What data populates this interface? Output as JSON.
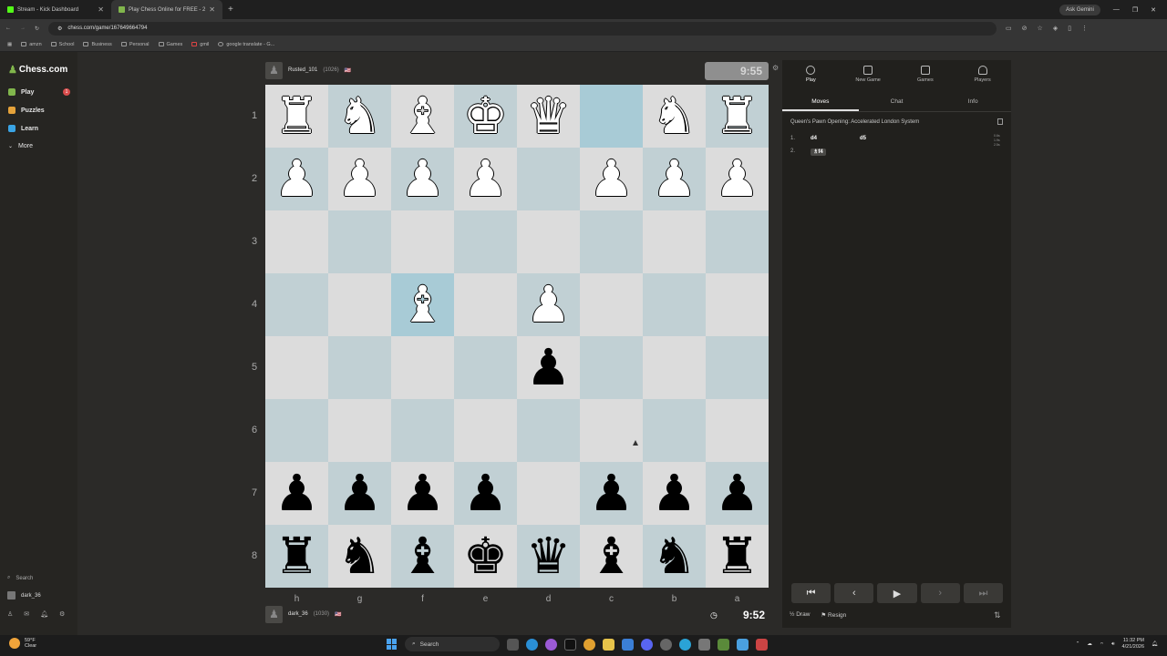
{
  "browser": {
    "tabs": [
      {
        "label": "Stream - Kick Dashboard",
        "active": false,
        "color": "#53fc18"
      },
      {
        "label": "Play Chess Online for FREE - 2",
        "active": true,
        "color": "#81b64c"
      }
    ],
    "url": "chess.com/game/167649664794",
    "gemini": "Ask Gemini",
    "bookmarks": [
      "amzn",
      "School",
      "Business",
      "Personal",
      "Games",
      "gmil",
      "google translate - G..."
    ]
  },
  "sidebar": {
    "logo": "Chess.com",
    "items": [
      {
        "label": "Play",
        "icon": "play-icon",
        "color": "#81b64c",
        "badge": "1"
      },
      {
        "label": "Puzzles",
        "icon": "puzzle-icon",
        "color": "#e5a23a"
      },
      {
        "label": "Learn",
        "icon": "learn-icon",
        "color": "#3aa4e5"
      },
      {
        "label": "More",
        "icon": "chevron-down-icon",
        "color": "#cccccc"
      }
    ],
    "search": "Search",
    "username": "dark_36",
    "mail_badge": "1"
  },
  "game": {
    "top_player": {
      "name": "Rusted_101",
      "rating": "(1026)",
      "clock": "9:55"
    },
    "bottom_player": {
      "name": "dark_36",
      "rating": "(1030)",
      "clock": "9:52"
    },
    "ranks": [
      "1",
      "2",
      "3",
      "4",
      "5",
      "6",
      "7",
      "8"
    ],
    "files": [
      "h",
      "g",
      "f",
      "e",
      "d",
      "c",
      "b",
      "a"
    ],
    "board": [
      [
        "♜",
        "♞",
        "♝",
        "♚",
        "♛",
        "",
        "♞",
        "♜"
      ],
      [
        "♟",
        "♟",
        "♟",
        "♟",
        "",
        "♟",
        "♟",
        "♟"
      ],
      [
        "",
        "",
        "",
        "",
        "",
        "",
        "",
        ""
      ],
      [
        "",
        "",
        "♝",
        "",
        "♟",
        "",
        "",
        ""
      ],
      [
        "",
        "",
        "",
        "",
        "♟",
        "",
        "",
        ""
      ],
      [
        "",
        "",
        "",
        "",
        "",
        "",
        "",
        ""
      ],
      [
        "♟",
        "♟",
        "♟",
        "♟",
        "",
        "♟",
        "♟",
        "♟"
      ],
      [
        "♜",
        "♞",
        "♝",
        "♚",
        "♛",
        "♝",
        "♞",
        "♜"
      ]
    ],
    "board_colors": [
      [
        "w",
        "w",
        "w",
        "w",
        "w",
        "",
        "w",
        "w"
      ],
      [
        "w",
        "w",
        "w",
        "w",
        "",
        "w",
        "w",
        "w"
      ],
      [
        "",
        "",
        "",
        "",
        "",
        "",
        "",
        ""
      ],
      [
        "",
        "",
        "w",
        "",
        "w",
        "",
        "",
        ""
      ],
      [
        "",
        "",
        "",
        "",
        "b",
        "",
        "",
        ""
      ],
      [
        "",
        "",
        "",
        "",
        "",
        "",
        "",
        ""
      ],
      [
        "b",
        "b",
        "b",
        "b",
        "",
        "b",
        "b",
        "b"
      ],
      [
        "b",
        "b",
        "b",
        "b",
        "b",
        "b",
        "b",
        "b"
      ]
    ]
  },
  "panel": {
    "tabs": [
      "Play",
      "New Game",
      "Games",
      "Players"
    ],
    "subtabs": [
      "Moves",
      "Chat",
      "Info"
    ],
    "opening": "Queen's Pawn Opening: Accelerated London System",
    "moves": [
      {
        "num": "1.",
        "white": "d4",
        "black": "d5"
      },
      {
        "num": "2.",
        "white": "♗f4",
        "black": ""
      }
    ],
    "times": [
      "0.6s",
      "1.9s",
      "2.5s"
    ],
    "draw": "Draw",
    "resign": "Resign"
  },
  "taskbar": {
    "temp": "59°F",
    "weather": "Clear",
    "search": "Search",
    "time": "11:32 PM",
    "date": "4/21/2026"
  }
}
